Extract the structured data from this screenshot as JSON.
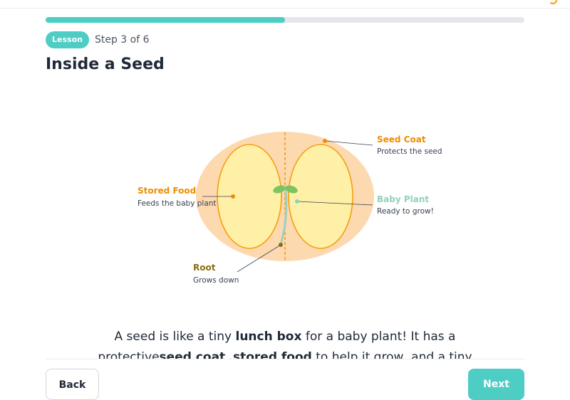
{
  "header": {
    "progress_percent": 50,
    "badge": "Lesson",
    "step": "Step 3 of 6",
    "title": "Inside a Seed"
  },
  "diagram": {
    "labels": {
      "seed_coat": {
        "title": "Seed Coat",
        "sub": "Protects the seed"
      },
      "stored_food": {
        "title": "Stored Food",
        "sub": "Feeds the baby plant"
      },
      "baby_plant": {
        "title": "Baby Plant",
        "sub": "Ready to grow!"
      },
      "root": {
        "title": "Root",
        "sub": "Grows down"
      }
    },
    "colors": {
      "seed_coat": "#fdd9b0",
      "cotyledon": "#fff0a8",
      "outline": "#f59e0b",
      "seed_coat_label": "#f08c00",
      "stored_food_label": "#f08c00",
      "baby_plant_label": "#8fd3b8",
      "root_label": "#8a6d12",
      "leaves": "#7cc462"
    }
  },
  "text": {
    "p1": "A seed is like a tiny ",
    "p1_bold": "lunch box",
    "p2": " for a baby plant! It has a",
    "p3": "protective",
    "p3_bold": "seed coat",
    "p4": ", ",
    "p4_bold": "stored food",
    "p5": " to help it grow, and a tiny"
  },
  "buttons": {
    "back": "Back",
    "next": "Next"
  }
}
